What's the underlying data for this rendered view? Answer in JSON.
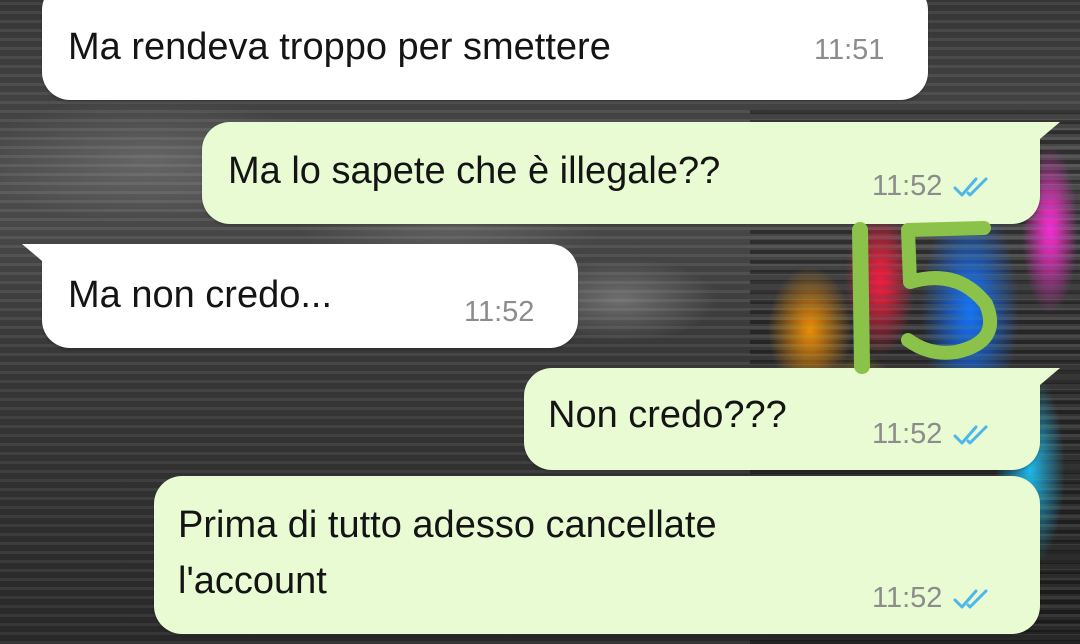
{
  "messages": [
    {
      "direction": "incoming",
      "text": "Ma rendeva troppo per smettere",
      "time": "11:51"
    },
    {
      "direction": "outgoing",
      "text": "Ma lo sapete che è illegale??",
      "time": "11:52",
      "status_icon": "double-check-read-icon"
    },
    {
      "direction": "incoming",
      "text": "Ma non credo...",
      "time": "11:52"
    },
    {
      "direction": "outgoing",
      "text": "Non credo???",
      "time": "11:52",
      "status_icon": "double-check-read-icon"
    },
    {
      "direction": "outgoing",
      "text_lines": [
        "Prima di tutto adesso cancellate",
        "l'account"
      ],
      "time": "11:52",
      "status_icon": "double-check-read-icon"
    }
  ],
  "annotation": {
    "text": "15",
    "color": "#8bc34a"
  },
  "colors": {
    "incoming_bubble": "#ffffff",
    "outgoing_bubble": "#e8fbd3",
    "timestamp": "#8c8c8c",
    "read_ticks": "#4fb6ec"
  }
}
